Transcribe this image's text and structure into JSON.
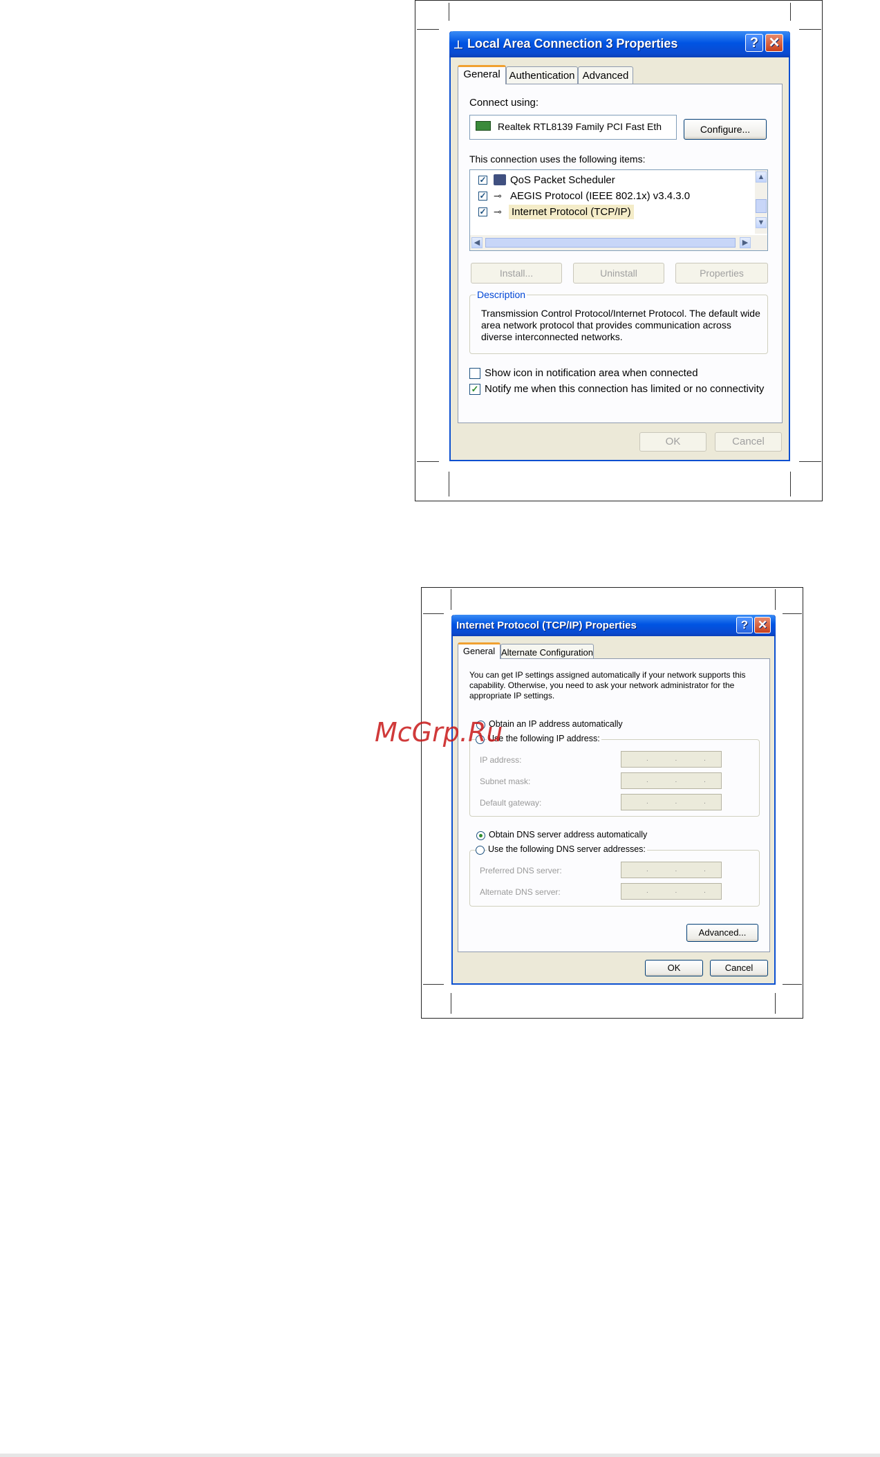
{
  "dialog1": {
    "title": "Local Area Connection 3 Properties",
    "tabs": [
      "General",
      "Authentication",
      "Advanced"
    ],
    "connect_using_label": "Connect using:",
    "adapter_name": "Realtek RTL8139 Family PCI Fast Eth",
    "configure_button": "Configure...",
    "items_label": "This connection uses the following items:",
    "items": [
      {
        "label": "QoS Packet Scheduler",
        "checked": true,
        "icon": "qos-icon"
      },
      {
        "label": "AEGIS Protocol (IEEE 802.1x) v3.4.3.0",
        "checked": true,
        "icon": "network-protocol-icon"
      },
      {
        "label": "Internet Protocol (TCP/IP)",
        "checked": true,
        "icon": "network-protocol-icon",
        "selected": true
      }
    ],
    "install_button": "Install...",
    "uninstall_button": "Uninstall",
    "properties_button": "Properties",
    "description_legend": "Description",
    "description_text": "Transmission Control Protocol/Internet Protocol. The default wide area network protocol that provides communication across diverse interconnected networks.",
    "show_icon_label": "Show icon in notification area when connected",
    "show_icon_checked": false,
    "notify_label": "Notify me when this connection has limited or no connectivity",
    "notify_checked": true,
    "ok_button": "OK",
    "cancel_button": "Cancel"
  },
  "dialog2": {
    "title": "Internet Protocol (TCP/IP) Properties",
    "tabs": [
      "General",
      "Alternate Configuration"
    ],
    "intro_text": "You can get IP settings assigned automatically if your network supports this capability. Otherwise, you need to ask your network administrator for the appropriate IP settings.",
    "obtain_ip_auto": "Obtain an IP address automatically",
    "use_following_ip": "Use the following IP address:",
    "ip_address_label": "IP address:",
    "subnet_mask_label": "Subnet mask:",
    "default_gateway_label": "Default gateway:",
    "obtain_dns_auto": "Obtain DNS server address automatically",
    "use_following_dns": "Use the following DNS server addresses:",
    "preferred_dns_label": "Preferred DNS server:",
    "alternate_dns_label": "Alternate DNS server:",
    "ip_placeholder": ". . .",
    "advanced_button": "Advanced...",
    "ok_button": "OK",
    "cancel_button": "Cancel",
    "selected_dns_option": "Obtain DNS server address automatically"
  },
  "watermark": "McGrp.Ru",
  "colors": {
    "title_bar": "#0054e3",
    "dialog_bg": "#ece9d8",
    "tab_active_accent": "#f0a030",
    "close_button": "#c7401c",
    "watermark": "#c81818"
  }
}
